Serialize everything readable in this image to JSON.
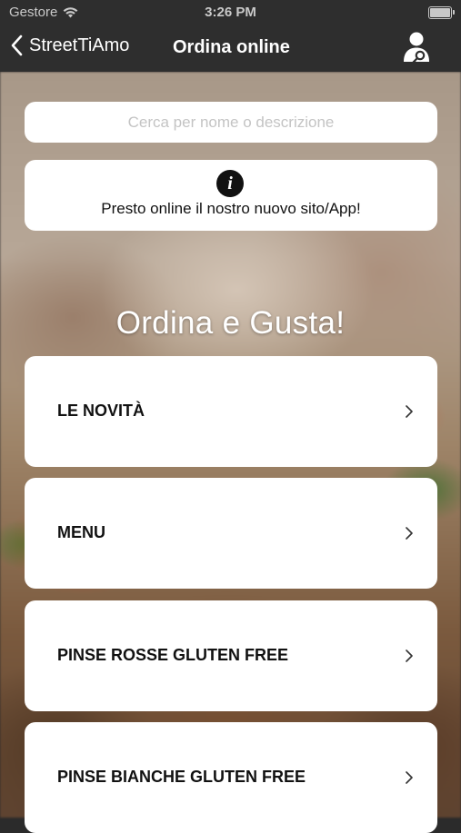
{
  "status_bar": {
    "carrier": "Gestore",
    "time": "3:26 PM"
  },
  "nav": {
    "back_label": "StreetTiAmo",
    "title": "Ordina online"
  },
  "search": {
    "placeholder": "Cerca per nome o descrizione"
  },
  "info": {
    "icon": "info-icon",
    "text": "Presto online il nostro nuovo sito/App!"
  },
  "heading": "Ordina e Gusta!",
  "categories": [
    {
      "label": "LE NOVITÀ"
    },
    {
      "label": "MENU"
    },
    {
      "label": "PINSE ROSSE GLUTEN FREE"
    },
    {
      "label": "PINSE BIANCHE GLUTEN FREE"
    }
  ],
  "colors": {
    "bar_background": "#2e2e2e",
    "card_background": "#ffffff",
    "text_dark": "#111111"
  }
}
